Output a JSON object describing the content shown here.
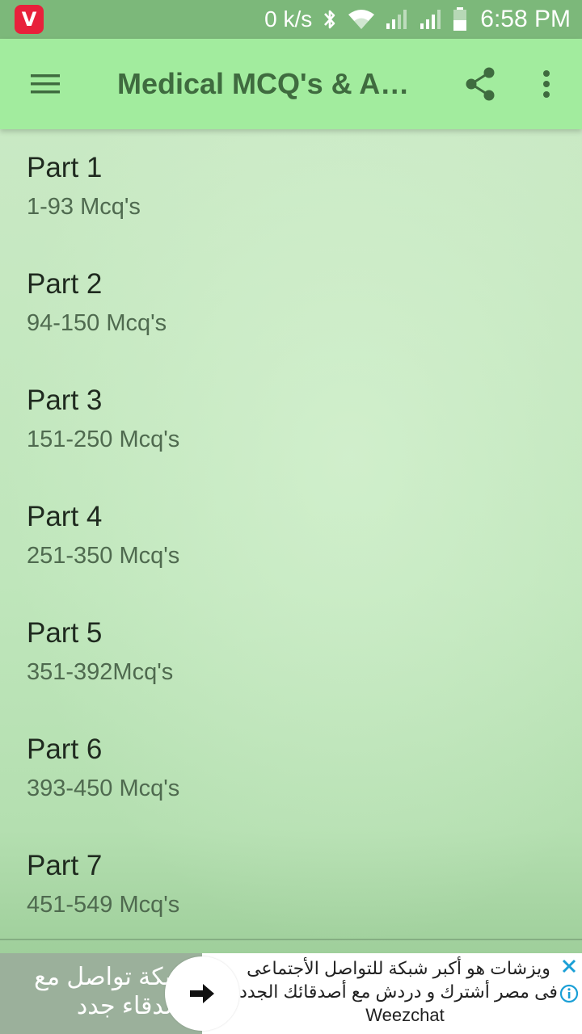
{
  "status_bar": {
    "app_icon_letter": "V",
    "net_speed": "0 k/s",
    "time": "6:58 PM",
    "icons": [
      "vidmate-icon",
      "bluetooth-icon",
      "wifi-icon",
      "signal-icon",
      "signal-icon",
      "battery-icon"
    ]
  },
  "app_bar": {
    "title": "Medical MCQ's & A…",
    "menu_icon": "hamburger-menu-icon",
    "share_icon": "share-icon",
    "more_icon": "more-vert-icon",
    "color": "#a2ec9e"
  },
  "list": {
    "items": [
      {
        "title": "Part 1",
        "subtitle": "1-93 Mcq's"
      },
      {
        "title": "Part 2",
        "subtitle": "94-150 Mcq's"
      },
      {
        "title": "Part 3",
        "subtitle": "151-250 Mcq's"
      },
      {
        "title": "Part 4",
        "subtitle": "251-350 Mcq's"
      },
      {
        "title": "Part 5",
        "subtitle": "351-392Mcq's"
      },
      {
        "title": "Part 6",
        "subtitle": "393-450 Mcq's"
      },
      {
        "title": "Part 7",
        "subtitle": "451-549 Mcq's"
      }
    ]
  },
  "ad": {
    "left_text_line1": "شبكة تواصل مع",
    "left_text_line2": "أصدقاء جدد",
    "text_line1": "ويزشات هو أكبر شبكة للتواصل الأجتماعى",
    "text_line2": "فى مصر أشترك و دردش مع أصدقائك الجدد",
    "brand": "Weezchat",
    "arrow_icon": "arrow-right-icon",
    "close_icon": "close-icon",
    "info_icon": "info-icon"
  }
}
